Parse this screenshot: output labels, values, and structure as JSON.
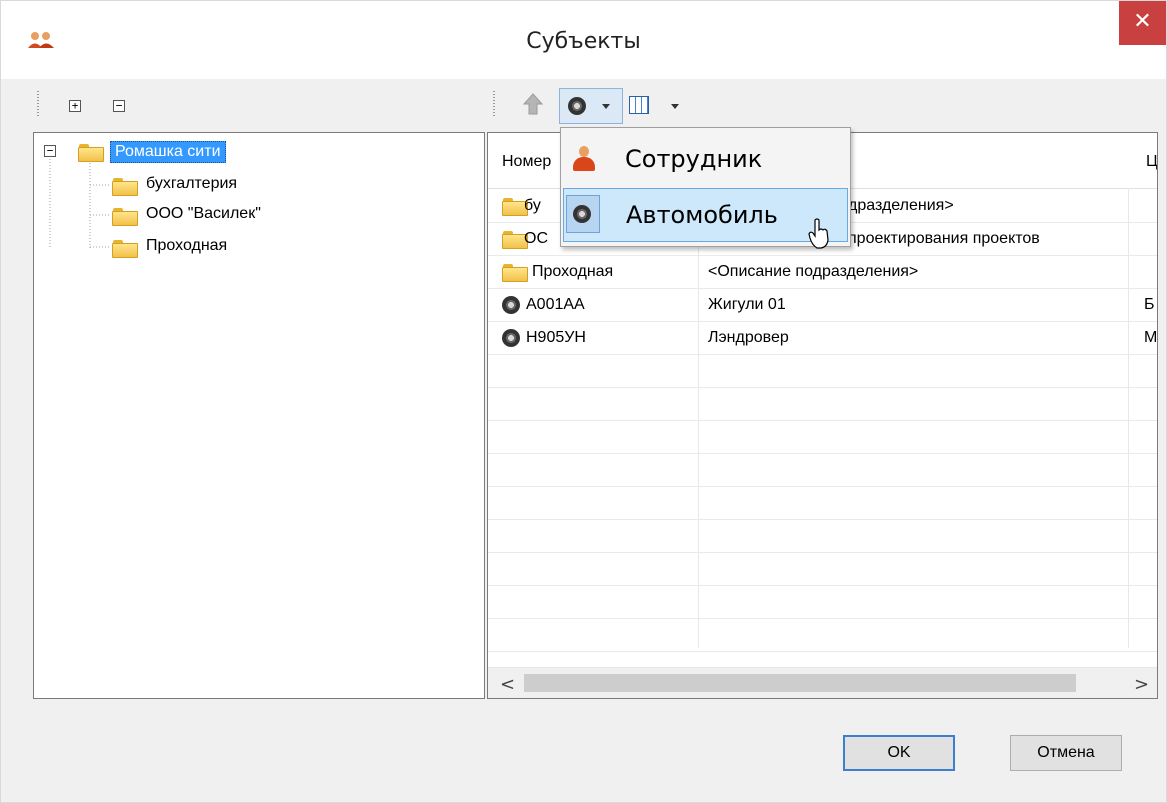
{
  "window": {
    "title": "Субъекты",
    "close_symbol": "✕",
    "icon": "users-icon"
  },
  "tree_toolbar": {
    "expand_all_symbol": "+",
    "collapse_all_symbol": "−"
  },
  "tree": {
    "collapse_symbol": "−",
    "root": {
      "label": "Ромашка сити",
      "icon": "folder-icon",
      "selected": true
    },
    "children": [
      {
        "label": "бухгалтерия",
        "icon": "folder-icon"
      },
      {
        "label": "ООО \"Василек\"",
        "icon": "folder-icon"
      },
      {
        "label": "Проходная",
        "icon": "folder-icon"
      }
    ]
  },
  "list_toolbar": {
    "up_icon": "arrow-up-icon",
    "add_icon": "wheel-icon",
    "view_icon": "grid-view-icon"
  },
  "list": {
    "columns": [
      "Номер",
      "",
      "Ц"
    ],
    "rows": [
      {
        "icon": "folder-icon",
        "col1": "бухгалтерия",
        "col2": "<Описание подразделения>",
        "col3": ""
      },
      {
        "icon": "folder-icon",
        "col1": "ООО \"Василек\"",
        "col2": "Фирма проектирования проектов",
        "col3": ""
      },
      {
        "icon": "folder-icon",
        "col1": "Проходная",
        "col2": "<Описание подразделения>",
        "col3": ""
      },
      {
        "icon": "wheel-icon",
        "col1": "А001АА",
        "col2": "Жигули 01",
        "col3": "Б"
      },
      {
        "icon": "wheel-icon",
        "col1": "Н905УН",
        "col2": "Лэндровер",
        "col3": "М"
      }
    ],
    "visible_fragments": {
      "row1_col1": "бу",
      "row1_col2": "дразделения>",
      "row2_col1": "ОС",
      "row2_col2": "проектирования проектов"
    },
    "scroll_left": "<",
    "scroll_right": ">"
  },
  "dropdown_menu": {
    "items": [
      {
        "label": "Сотрудник",
        "icon": "person-icon"
      },
      {
        "label": "Автомобиль",
        "icon": "wheel-icon",
        "highlighted": true
      }
    ]
  },
  "buttons": {
    "ok": "OK",
    "cancel": "Отмена"
  }
}
